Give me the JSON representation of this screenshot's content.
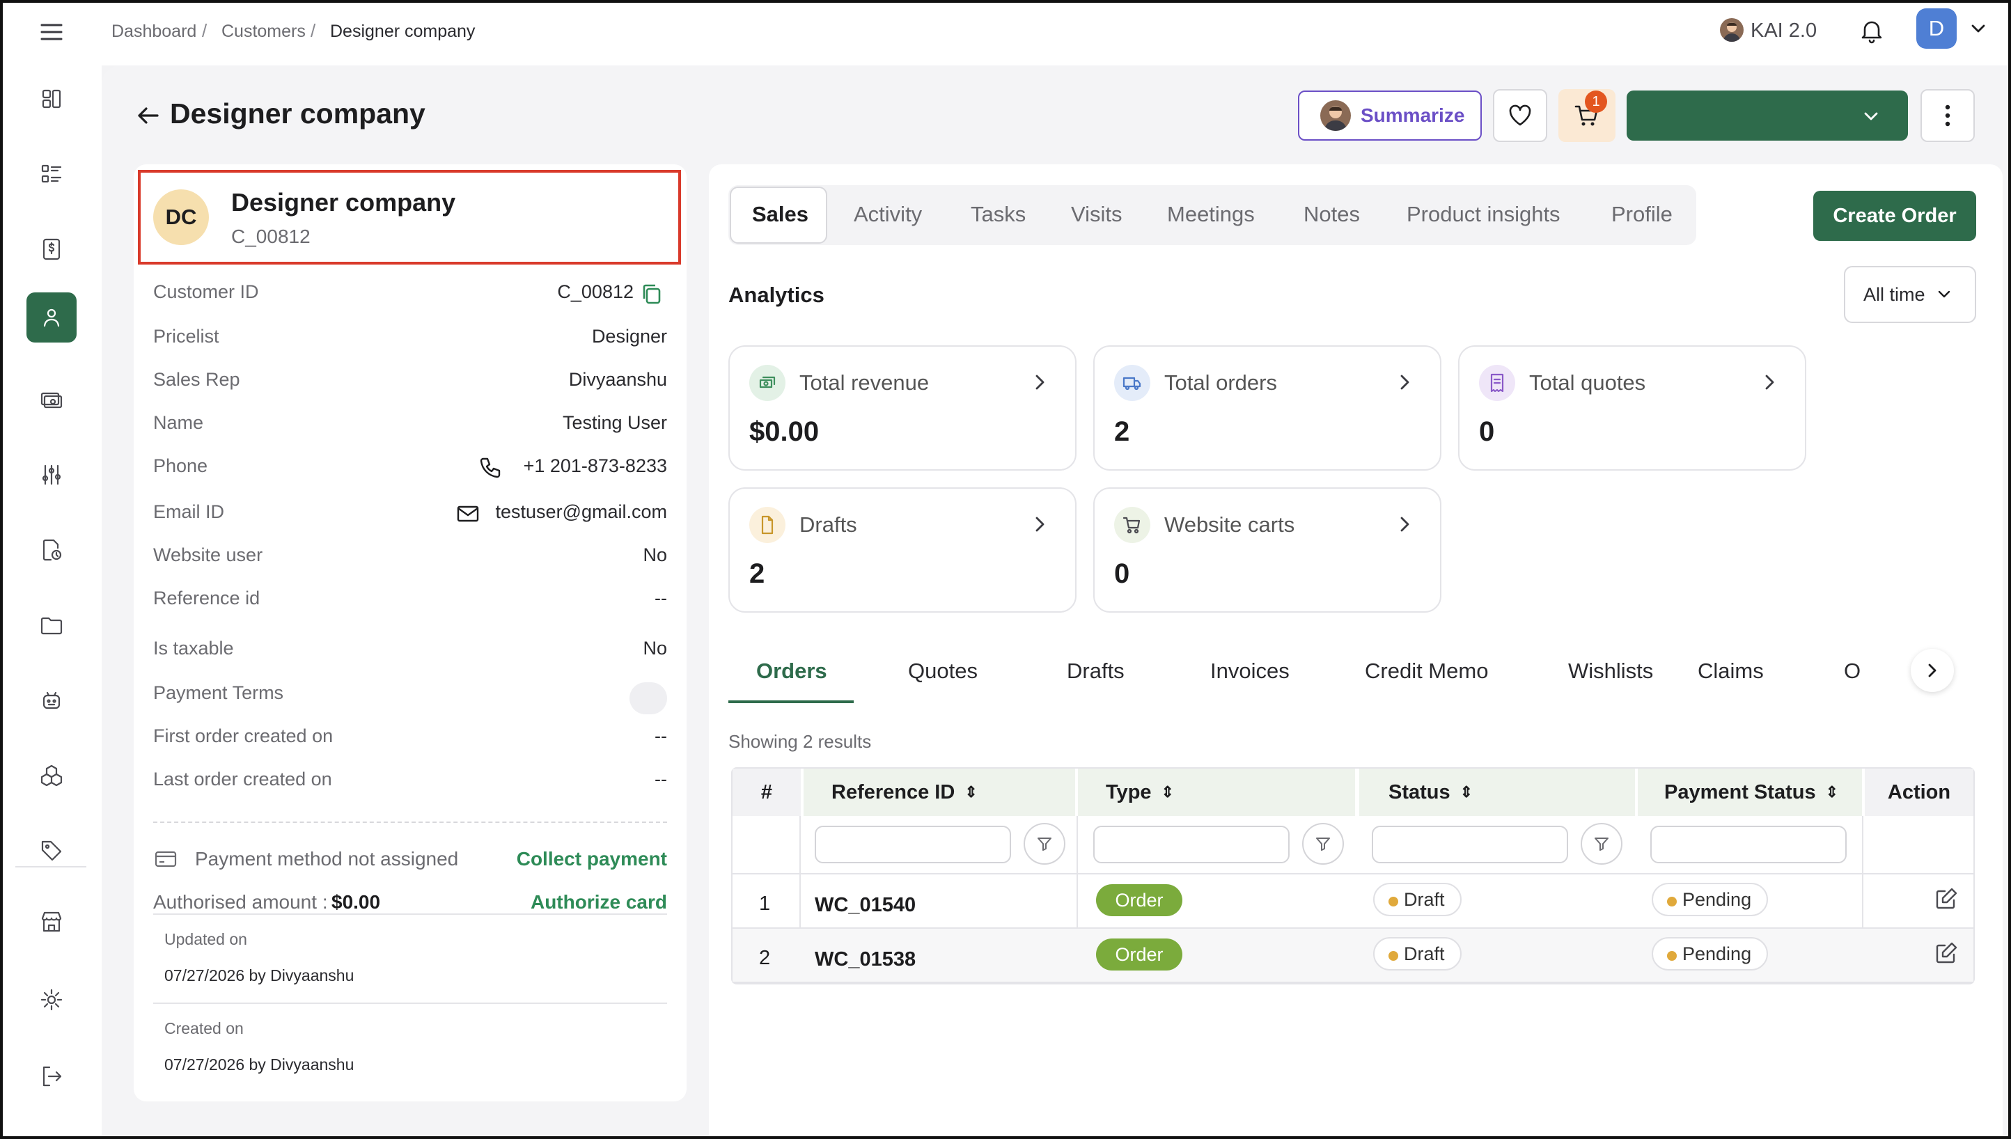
{
  "breadcrumb": [
    "Dashboard",
    "Customers",
    "Designer company"
  ],
  "header": {
    "kai_label": "KAI 2.0",
    "avatar_initial": "D"
  },
  "page": {
    "title": "Designer company"
  },
  "actions": {
    "summarize": "Summarize",
    "cart_count": "1",
    "create_order": "Create Order"
  },
  "customer": {
    "initials": "DC",
    "name": "Designer company",
    "code": "C_00812",
    "fields": [
      {
        "label": "Customer ID",
        "value": "C_00812"
      },
      {
        "label": "Pricelist",
        "value": "Designer"
      },
      {
        "label": "Sales Rep",
        "value": "Divyaanshu"
      },
      {
        "label": "Name",
        "value": "Testing User"
      },
      {
        "label": "Phone",
        "value": "+1 201-873-8233"
      },
      {
        "label": "Email ID",
        "value": "testuser@gmail.com"
      },
      {
        "label": "Website user",
        "value": "No"
      },
      {
        "label": "Reference id",
        "value": "--"
      },
      {
        "label": "Is taxable",
        "value": "No"
      },
      {
        "label": "Payment Terms",
        "value": "--"
      },
      {
        "label": "First order created on",
        "value": "--"
      },
      {
        "label": "Last order created on",
        "value": "--"
      }
    ],
    "payment_method": "Payment method not assigned",
    "collect_payment": "Collect payment",
    "authorised_label": "Authorised amount :",
    "authorised_value": "$0.00",
    "authorize_card": "Authorize card",
    "updated_label": "Updated on",
    "updated_value": "07/27/2026 by Divyaanshu",
    "created_label": "Created on",
    "created_value": "07/27/2026 by Divyaanshu"
  },
  "tabs": [
    "Sales",
    "Activity",
    "Tasks",
    "Visits",
    "Meetings",
    "Notes",
    "Product insights",
    "Profile"
  ],
  "analytics": {
    "title": "Analytics",
    "range": "All time",
    "cards": [
      {
        "title": "Total revenue",
        "value": "$0.00",
        "icon": "money-icon",
        "color": "#e3f1e6"
      },
      {
        "title": "Total orders",
        "value": "2",
        "icon": "truck-icon",
        "color": "#e4ecf9"
      },
      {
        "title": "Total quotes",
        "value": "0",
        "icon": "receipt-icon",
        "color": "#efe6f8"
      },
      {
        "title": "Drafts",
        "value": "2",
        "icon": "document-icon",
        "color": "#fbf0dc"
      },
      {
        "title": "Website carts",
        "value": "0",
        "icon": "cart-icon",
        "color": "#edf3e6"
      }
    ]
  },
  "order_tabs": [
    "Orders",
    "Quotes",
    "Drafts",
    "Invoices",
    "Credit Memo",
    "Wishlists",
    "Claims",
    "O"
  ],
  "results_text": "Showing 2 results",
  "table": {
    "headers": [
      "#",
      "Reference ID",
      "Type",
      "Status",
      "Payment Status",
      "Action"
    ],
    "rows": [
      {
        "num": "1",
        "ref": "WC_01540",
        "type": "Order",
        "status": "Draft",
        "payment": "Pending"
      },
      {
        "num": "2",
        "ref": "WC_01538",
        "type": "Order",
        "status": "Draft",
        "payment": "Pending"
      }
    ]
  },
  "colors": {
    "brand": "#2e6b4b",
    "accent_purple": "#6b4fc6",
    "highlight_red": "#d93a2b"
  }
}
